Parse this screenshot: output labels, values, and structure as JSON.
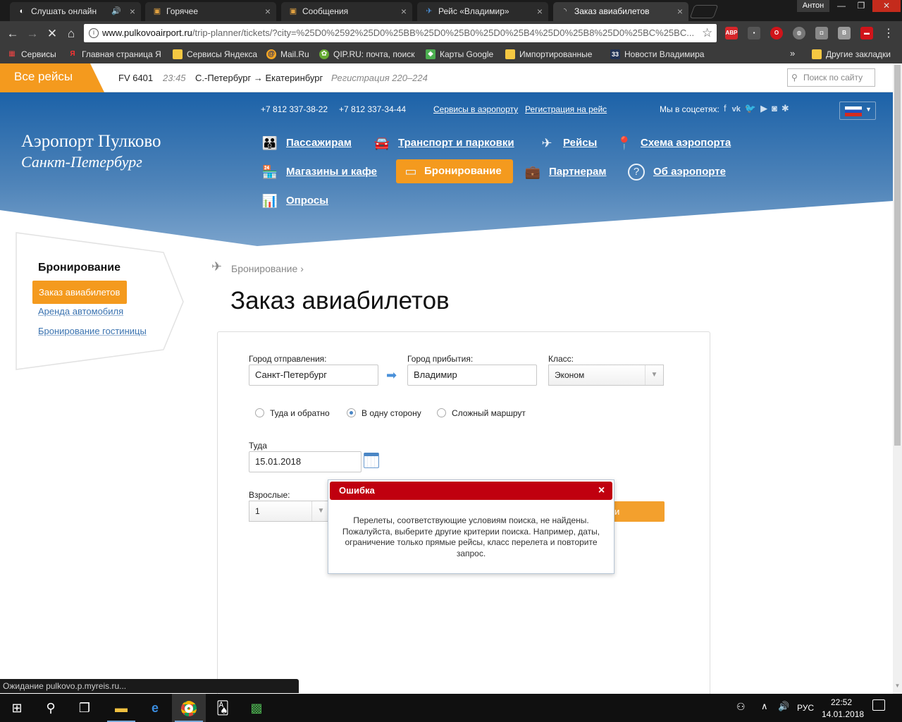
{
  "browser": {
    "tabs": [
      {
        "title": "Слушать онлайн",
        "icon": "radio-icon"
      },
      {
        "title": "Горячее",
        "icon": "box-icon"
      },
      {
        "title": "Сообщения",
        "icon": "box-icon"
      },
      {
        "title": "Рейс «Владимир»",
        "icon": "flight-icon"
      },
      {
        "title": "Заказ авиабилетов",
        "icon": "loading-icon"
      }
    ],
    "profile_name": "Антон",
    "url_domain": "www.pulkovoairport.ru",
    "url_path": "/trip-planner/tickets/?city=%25D0%2592%25D0%25BB%25D0%25B0%25D0%25B4%25D0%25B8%25D0%25BC%25BC...",
    "extensions": [
      "ABP",
      "B"
    ],
    "bookmarks": [
      "Сервисы",
      "Главная страница Я",
      "Сервисы Яндекса",
      "Mail.Ru",
      "QIP.RU: почта, поиск",
      "Карты Google",
      "Импортированные",
      "Новости Владимира"
    ],
    "other_bookmarks": "Другие закладки",
    "status_text": "Ожидание pulkovo.p.myreis.ru..."
  },
  "site": {
    "all_flights": "Все рейсы",
    "ticker": {
      "flight": "FV 6401",
      "time": "23:45",
      "route": "С.-Петербург → Екатеринбург",
      "checkin": "Регистрация 220–224"
    },
    "search_placeholder": "Поиск по сайту",
    "phones": [
      "+7 812 337-38-22",
      "+7 812 337-34-44"
    ],
    "links": {
      "services": "Сервисы в аэропорту",
      "registration": "Регистрация на рейс"
    },
    "social_label": "Мы в соцсетях:",
    "logo": {
      "line1": "Аэропорт Пулково",
      "line2": "Санкт-Петербург"
    },
    "nav": {
      "passengers": "Пассажирам",
      "transport": "Транспорт и парковки",
      "flights": "Рейсы",
      "scheme": "Схема аэропорта",
      "shops": "Магазины и кафе",
      "booking": "Бронирование",
      "partners": "Партнерам",
      "about": "Об аэропорте",
      "polls": "Опросы"
    },
    "sidebar": {
      "title": "Бронирование",
      "items": [
        "Заказ авиабилетов",
        "Аренда автомобиля",
        "Бронирование гостиницы"
      ]
    },
    "breadcrumb": "Бронирование",
    "page_title": "Заказ авиабилетов",
    "form": {
      "from_label": "Город отправления:",
      "from_value": "Санкт-Петербург",
      "to_label": "Город прибытия:",
      "to_value": "Владимир",
      "class_label": "Класс:",
      "class_value": "Эконом",
      "trip_types": [
        "Туда и обратно",
        "В одну сторону",
        "Сложный маршрут"
      ],
      "trip_selected": "В одну сторону",
      "depart_label": "Туда",
      "depart_value": "15.01.2018",
      "adults_label": "Взрослые:",
      "adults_value": "1",
      "search_button_visible": "и"
    },
    "error_modal": {
      "title": "Ошибка",
      "message": "Перелеты, соответствующие условиям поиска, не найдены. Пожалуйста, выберите другие критерии поиска. Например, даты, ограничение только прямые рейсы, класс перелета и повторите запрос."
    }
  },
  "taskbar": {
    "lang": "РУС",
    "time": "22:52",
    "date": "14.01.2018"
  },
  "colors": {
    "accent": "#f49a1e",
    "header_blue": "#1c62a8",
    "error_red": "#c0000f",
    "link_blue": "#3b73b0"
  }
}
